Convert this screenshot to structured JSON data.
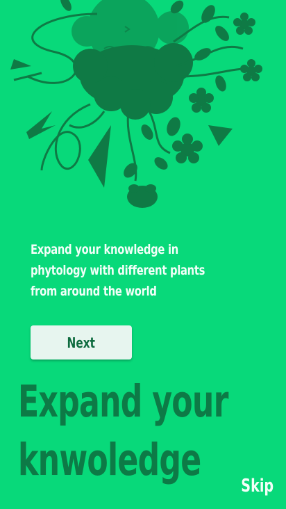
{
  "onboarding": {
    "subtitle": "Expand your knowledge in phytology with different plants from around the world",
    "next_label": "Next",
    "headline_line1": "Expand your",
    "headline_line2": "knwoledge",
    "skip_label": "Skip"
  },
  "colors": {
    "background": "#08d97a",
    "illustration": "#0f7a45",
    "button_bg": "#e7f5ef",
    "button_text": "#0e6b3f",
    "headline": "#0d7a46",
    "light_text": "#f2fff8"
  },
  "illustration": {
    "icon": "plant-character-illustration"
  }
}
